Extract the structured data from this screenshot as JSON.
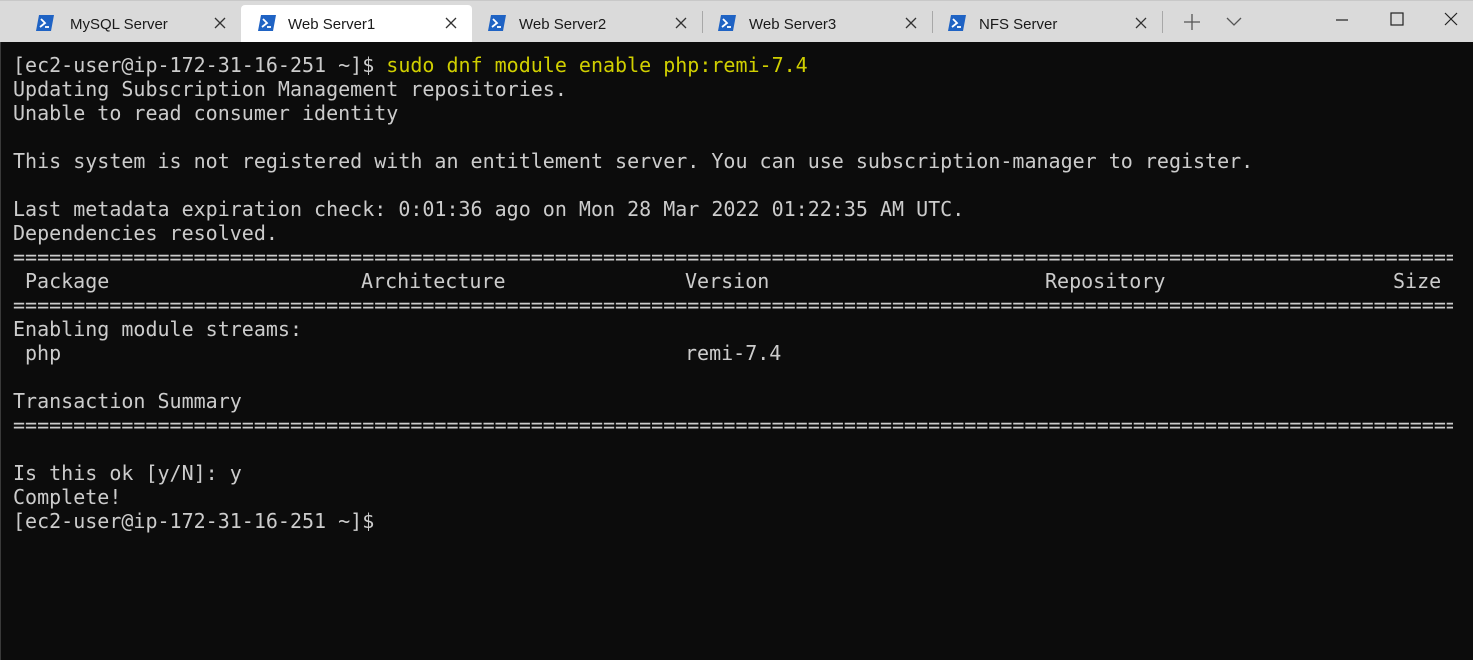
{
  "window": {
    "tabs": [
      {
        "title": "MySQL Server",
        "active": false,
        "icon": "powershell-icon"
      },
      {
        "title": "Web Server1",
        "active": true,
        "icon": "powershell-icon"
      },
      {
        "title": "Web Server2",
        "active": false,
        "icon": "powershell-icon"
      },
      {
        "title": "Web Server3",
        "active": false,
        "icon": "powershell-icon"
      },
      {
        "title": "NFS Server",
        "active": false,
        "icon": "powershell-icon"
      }
    ],
    "icon_color": "#1f63c4",
    "controls": [
      "new-tab-icon",
      "dropdown-icon",
      "minimize-icon",
      "maximize-icon",
      "close-icon"
    ]
  },
  "terminal": {
    "prompt": "[ec2-user@ip-172-31-16-251 ~]$",
    "command": " sudo dnf module enable php:remi-7.4",
    "command_color": "#d0cf00",
    "lines_a": [
      "Updating Subscription Management repositories.",
      "Unable to read consumer identity",
      "",
      "This system is not registered with an entitlement server. You can use subscription-manager to register.",
      "",
      "Last metadata expiration check: 0:01:36 ago on Mon 28 Mar 2022 01:22:35 AM UTC.",
      "Dependencies resolved."
    ],
    "separator": "================================================================================================================================================================",
    "columns": {
      "package": "Package",
      "architecture": "Architecture",
      "version": "Version",
      "repository": "Repository",
      "size": "Size"
    },
    "enabling_label": "Enabling module streams:",
    "module_row": {
      "package": "php",
      "version": "remi-7.4"
    },
    "summary_label": "Transaction Summary",
    "confirm_line": "Is this ok [y/N]: y",
    "complete_line": "Complete!",
    "final_prompt": "[ec2-user@ip-172-31-16-251 ~]$"
  }
}
